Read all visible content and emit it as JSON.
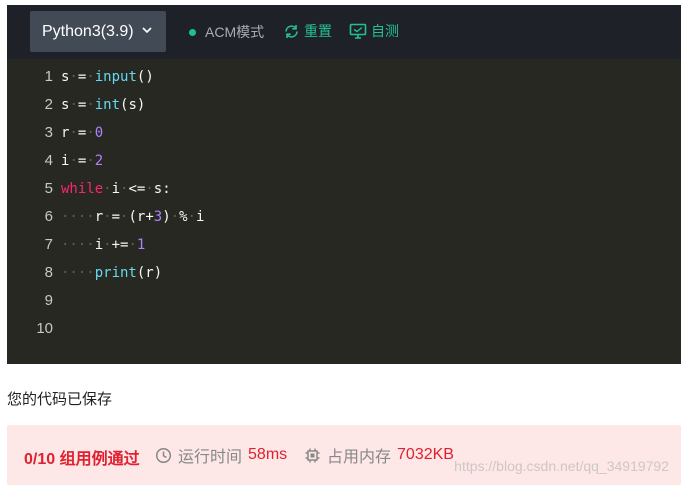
{
  "toolbar": {
    "language": "Python3(3.9)",
    "mode": "ACM模式",
    "reset": "重置",
    "self_test": "自测"
  },
  "editor": {
    "line_numbers": [
      "1",
      "2",
      "3",
      "4",
      "5",
      "6",
      "7",
      "8",
      "9",
      "10"
    ],
    "lines": [
      [
        [
          "s"
        ],
        [
          " ",
          " ws"
        ],
        [
          "="
        ],
        [
          " ",
          " ws"
        ],
        [
          "input",
          "fn"
        ],
        [
          "()"
        ]
      ],
      [
        [
          "s"
        ],
        [
          " ",
          " ws"
        ],
        [
          "="
        ],
        [
          " ",
          " ws"
        ],
        [
          "int",
          "fn"
        ],
        [
          "(s)"
        ]
      ],
      [
        [
          "r"
        ],
        [
          " ",
          " ws"
        ],
        [
          "="
        ],
        [
          " ",
          " ws"
        ],
        [
          "0",
          "num"
        ]
      ],
      [
        [
          "i"
        ],
        [
          " ",
          " ws"
        ],
        [
          "="
        ],
        [
          " ",
          " ws"
        ],
        [
          "2",
          "num"
        ]
      ],
      [
        [
          "while",
          "kw"
        ],
        [
          " ",
          " ws"
        ],
        [
          "i"
        ],
        [
          " ",
          " ws"
        ],
        [
          "<="
        ],
        [
          " ",
          " ws"
        ],
        [
          "s:"
        ]
      ],
      [
        [
          "····",
          "ws"
        ],
        [
          "r"
        ],
        [
          " ",
          " ws"
        ],
        [
          "="
        ],
        [
          " ",
          " ws"
        ],
        [
          "(r+"
        ],
        [
          "3",
          "num"
        ],
        [
          ")"
        ],
        [
          " ",
          " ws"
        ],
        [
          "%"
        ],
        [
          " ",
          " ws"
        ],
        [
          "i"
        ]
      ],
      [
        [
          "····",
          "ws"
        ],
        [
          "i"
        ],
        [
          " ",
          " ws"
        ],
        [
          "+="
        ],
        [
          " ",
          " ws"
        ],
        [
          "1",
          "num"
        ]
      ],
      [
        [
          "····",
          "ws"
        ],
        [
          "print",
          "fn"
        ],
        [
          "(r)"
        ]
      ],
      [],
      []
    ]
  },
  "status": {
    "saved": "您的代码已保存"
  },
  "result": {
    "summary": "0/10 组用例通过",
    "time_label": "运行时间",
    "time_value": "58ms",
    "memory_label": "占用内存",
    "memory_value": "7032KB",
    "watermark": "https://blog.csdn.net/qq_34919792"
  },
  "colors": {
    "accent": "#25c08f",
    "error": "#e0212f",
    "error_bg": "#fde7e7",
    "editor_bg": "#272822"
  }
}
